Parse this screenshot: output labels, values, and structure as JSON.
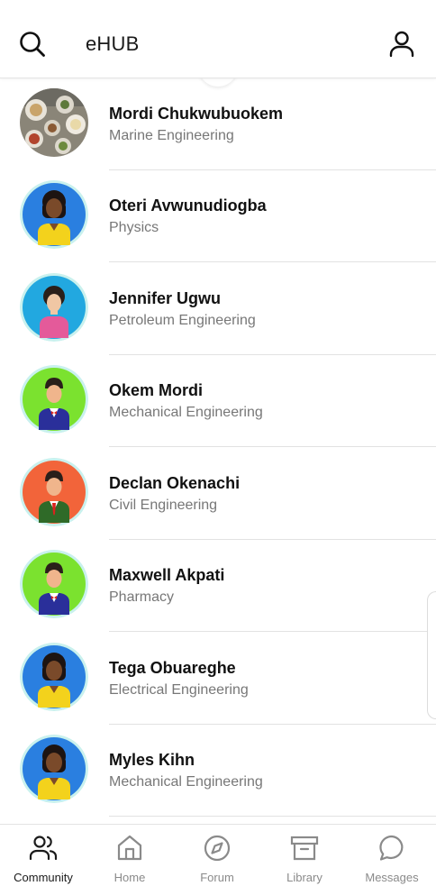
{
  "header": {
    "title": "eHUB",
    "left_icon": "search-icon",
    "right_icon": "user-icon"
  },
  "members": [
    {
      "name": "Mordi Chukwubuokem",
      "department": "Marine Engineering",
      "avatar": "food-photo"
    },
    {
      "name": "Oteri Avwunudiogba",
      "department": "Physics",
      "avatar": "female-avatar-blue"
    },
    {
      "name": "Jennifer Ugwu",
      "department": "Petroleum Engineering",
      "avatar": "female-avatar-skyblue"
    },
    {
      "name": "Okem Mordi",
      "department": "Mechanical Engineering",
      "avatar": "male-avatar-green"
    },
    {
      "name": "Declan Okenachi",
      "department": "Civil Engineering",
      "avatar": "male-avatar-orange"
    },
    {
      "name": "Maxwell Akpati",
      "department": "Pharmacy",
      "avatar": "male-avatar-green"
    },
    {
      "name": "Tega Obuareghe",
      "department": "Electrical Engineering",
      "avatar": "female-avatar-blue"
    },
    {
      "name": "Myles Kihn",
      "department": "Mechanical Engineering",
      "avatar": "female-avatar-blue"
    }
  ],
  "bottom_nav": [
    {
      "label": "Community",
      "icon": "users-icon",
      "active": true
    },
    {
      "label": "Home",
      "icon": "home-icon",
      "active": false
    },
    {
      "label": "Forum",
      "icon": "compass-icon",
      "active": false
    },
    {
      "label": "Library",
      "icon": "archive-icon",
      "active": false
    },
    {
      "label": "Messages",
      "icon": "chat-bubble-icon",
      "active": false
    }
  ],
  "colors": {
    "text_primary": "#111111",
    "text_secondary": "#777777",
    "nav_inactive": "#8a8a8a",
    "avatar_blue": "#2a7fe0",
    "avatar_skyblue": "#22a8e0",
    "avatar_green": "#7be22f",
    "avatar_orange": "#f2643a"
  }
}
